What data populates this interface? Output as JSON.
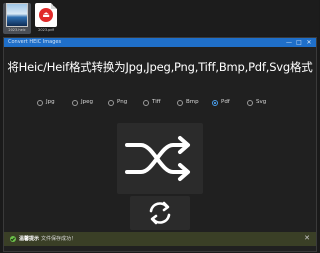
{
  "desktop": {
    "files": [
      {
        "name": "2023.heic"
      },
      {
        "name": "2023.pdf"
      }
    ]
  },
  "window": {
    "title": "Convert HEIC Images",
    "controls": {
      "minimize": "—",
      "maximize": "□",
      "close": "✕"
    }
  },
  "main": {
    "heading": "将Heic/Heif格式转换为Jpg,Jpeg,Png,Tiff,Bmp,Pdf,Svg格式",
    "formats": [
      {
        "label": "Jpg",
        "selected": false
      },
      {
        "label": "Jpeg",
        "selected": false
      },
      {
        "label": "Png",
        "selected": false
      },
      {
        "label": "Tiff",
        "selected": false
      },
      {
        "label": "Bmp",
        "selected": false
      },
      {
        "label": "Pdf",
        "selected": true
      },
      {
        "label": "Svg",
        "selected": false
      }
    ],
    "convert_icon": "shuffle-icon",
    "refresh_icon": "refresh-icon"
  },
  "status": {
    "title": "温馨提示",
    "message": "文件保存成功！",
    "dismiss": "✕",
    "accent": "#6cc04a"
  },
  "colors": {
    "titlebar": "#1f6fc9",
    "radio_selected": "#4a9eea",
    "pdf_badge": "#e02b2b"
  }
}
